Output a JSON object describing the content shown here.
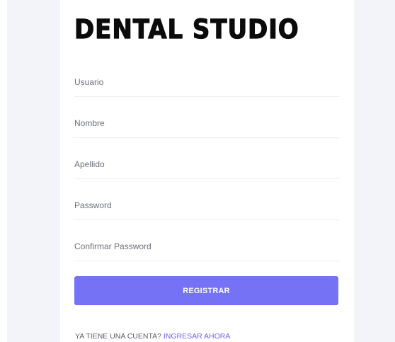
{
  "brand": {
    "logo_text": "DENTAL STUDIO"
  },
  "form": {
    "fields": [
      {
        "placeholder": "Usuario",
        "value": ""
      },
      {
        "placeholder": "Nombre",
        "value": ""
      },
      {
        "placeholder": "Apellido",
        "value": ""
      },
      {
        "placeholder": "Password",
        "value": ""
      },
      {
        "placeholder": "Confirmar Password",
        "value": ""
      }
    ],
    "submit_label": "REGISTRAR"
  },
  "footer": {
    "prompt_text": "YA TIENE UNA CUENTA?",
    "login_link": "INGRESAR AHORA"
  },
  "colors": {
    "accent": "#7572f6",
    "link": "#6b63f2",
    "page_background": "#f3f3fa"
  }
}
